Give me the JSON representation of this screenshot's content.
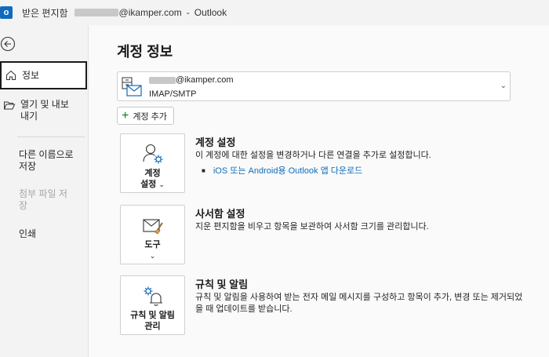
{
  "window": {
    "title_prefix": "받은 편지함",
    "title_email_suffix": "@ikamper.com",
    "title_sep": "-",
    "app_name": "Outlook",
    "app_icon_letter": "o"
  },
  "sidebar": {
    "items": [
      {
        "label": "정보"
      },
      {
        "label": "열기 및 내보\n내기"
      },
      {
        "label": "다른 이름으로\n저장"
      },
      {
        "label": "첨부 파일 저\n장"
      },
      {
        "label": "인쇄"
      }
    ]
  },
  "main": {
    "page_title": "계정 정보",
    "account": {
      "email_suffix": "@ikamper.com",
      "type": "IMAP/SMTP"
    },
    "add_account_label": "계정 추가",
    "sections": [
      {
        "tile_label_line1": "계정",
        "tile_label_line2": "설정",
        "title": "계정 설정",
        "desc": "이 계정에 대한 설정을 변경하거나 다른 연결을 추가로 설정합니다.",
        "link": "iOS 또는 Android용 Outlook 앱 다운로드"
      },
      {
        "tile_label_line1": "도구",
        "title": "사서함 설정",
        "desc": "지운 편지함을 비우고 항목을 보관하여 사서함 크기를 관리합니다."
      },
      {
        "tile_label_line1": "규칙 및 알림",
        "tile_label_line2": "관리",
        "title": "규칙 및 알림",
        "desc": "규칙 및 알림을 사용하여 받는 전자 메일 메시지를 구성하고 항목이 추가, 변경 또는 제거되었을 때 업데이트를 받습니다."
      }
    ]
  },
  "colors": {
    "accent": "#0f6cbd",
    "add_plus": "#0e7a0d"
  }
}
